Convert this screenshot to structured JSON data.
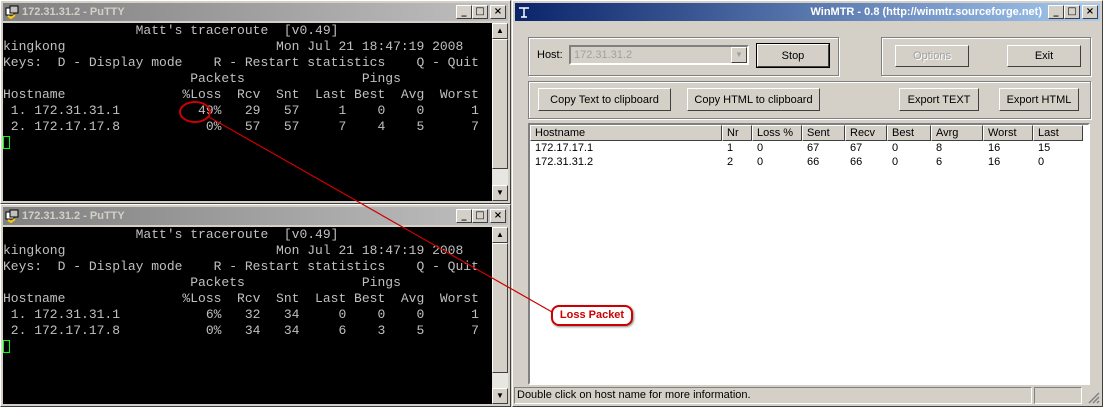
{
  "putty_top": {
    "title": "172.31.31.2 - PuTTY",
    "lines": [
      "                 Matt's traceroute  [v0.49]",
      "kingkong                           Mon Jul 21 18:47:19 2008",
      "Keys:  D - Display mode    R - Restart statistics    Q - Quit",
      "                        Packets               Pings",
      "Hostname               %Loss  Rcv  Snt  Last Best  Avg  Worst",
      " 1. 172.31.31.1          49%   29   57     1    0    0      1",
      " 2. 172.17.17.8           0%   57   57     7    4    5      7"
    ]
  },
  "putty_bottom": {
    "title": "172.31.31.2 - PuTTY",
    "lines": [
      "                 Matt's traceroute  [v0.49]",
      "kingkong                           Mon Jul 21 18:47:19 2008",
      "Keys:  D - Display mode    R - Restart statistics    Q - Quit",
      "                        Packets               Pings",
      "Hostname               %Loss  Rcv  Snt  Last Best  Avg  Worst",
      " 1. 172.31.31.1           6%   32   34     0    0    0      1",
      " 2. 172.17.17.8           0%   34   34     6    3    5      7"
    ]
  },
  "winmtr": {
    "title": "WinMTR - 0.8 (http://winmtr.sourceforge.net)",
    "host_label": "Host:",
    "host_value": "172.31.31.2",
    "stop": "Stop",
    "options": "Options",
    "exit": "Exit",
    "copy_text": "Copy Text to clipboard",
    "copy_html": "Copy HTML to clipboard",
    "export_text": "Export TEXT",
    "export_html": "Export HTML",
    "columns": [
      "Hostname",
      "Nr",
      "Loss %",
      "Sent",
      "Recv",
      "Best",
      "Avrg",
      "Worst",
      "Last"
    ],
    "rows": [
      [
        "172.17.17.1",
        "1",
        "0",
        "67",
        "67",
        "0",
        "8",
        "16",
        "15"
      ],
      [
        "172.31.31.2",
        "2",
        "0",
        "66",
        "66",
        "0",
        "6",
        "16",
        "0"
      ]
    ],
    "status": "Double click on host name for more information."
  },
  "annotation": {
    "label": "Loss Packet",
    "color": "#cc0000"
  },
  "icons": {
    "putty": "putty-icon",
    "winmtr": "winmtr-icon"
  }
}
